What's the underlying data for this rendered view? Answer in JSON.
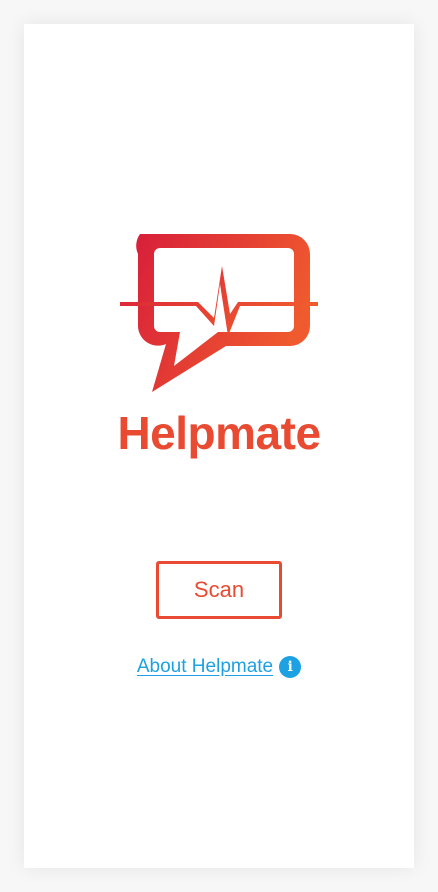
{
  "brand": {
    "name": "Helpmate",
    "accent_color": "#e84a32",
    "logo_icon": "chat-bubble-heartbeat-icon"
  },
  "actions": {
    "scan_label": "Scan"
  },
  "about": {
    "link_text": "About Helpmate",
    "icon": "info-icon",
    "icon_glyph": "i",
    "color": "#1da1e2"
  }
}
